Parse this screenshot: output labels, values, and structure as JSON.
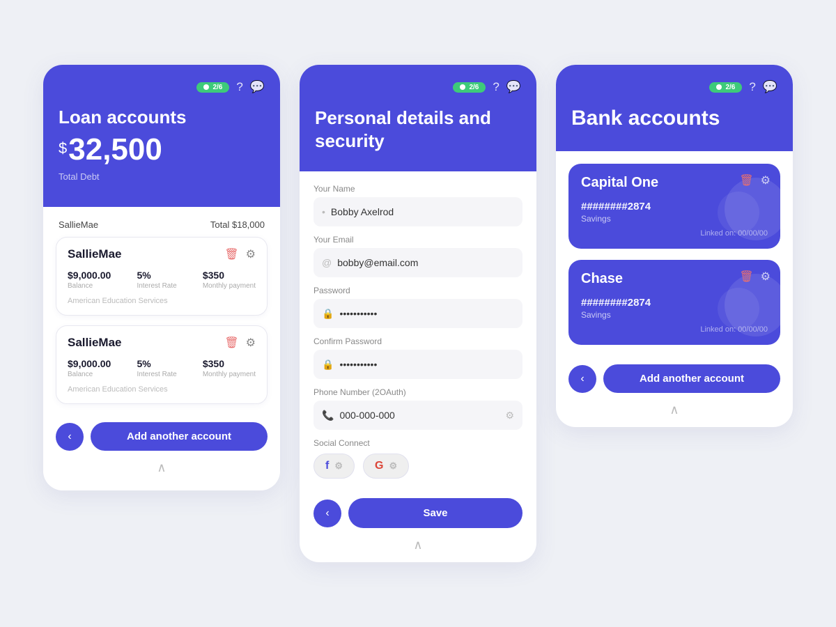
{
  "screen1": {
    "toggle": "2/6",
    "title": "Loan accounts",
    "amount": "32,500",
    "subtitle": "Total Debt",
    "section_name": "SallieMae",
    "section_total": "Total $18,000",
    "accounts": [
      {
        "name": "SallieMae",
        "balance_value": "$9,000.00",
        "balance_label": "Balance",
        "rate_value": "5%",
        "rate_label": "Interest Rate",
        "payment_value": "$350",
        "payment_label": "Monthly payment",
        "provider": "American Education Services"
      },
      {
        "name": "SallieMae",
        "balance_value": "$9,000.00",
        "balance_label": "Balance",
        "rate_value": "5%",
        "rate_label": "Interest Rate",
        "payment_value": "$350",
        "payment_label": "Monthly payment",
        "provider": "American Education Services"
      }
    ],
    "add_btn": "Add another account"
  },
  "screen2": {
    "toggle": "2/6",
    "title": "Personal details and security",
    "fields": {
      "name_label": "Your Name",
      "name_value": "Bobby Axelrod",
      "email_label": "Your Email",
      "email_value": "bobby@email.com",
      "password_label": "Password",
      "password_value": "••••••••••••",
      "confirm_label": "Confirm Password",
      "confirm_value": "••••••••••••",
      "phone_label": "Phone Number (2OAuth)",
      "phone_value": "000-000-000"
    },
    "social_label": "Social Connect",
    "facebook_label": "f",
    "google_label": "G",
    "save_btn": "Save"
  },
  "screen3": {
    "toggle": "2/6",
    "title": "Bank accounts",
    "cards": [
      {
        "name": "Capital One",
        "number": "########2874",
        "type": "Savings",
        "linked": "Linked on: 00/00/00"
      },
      {
        "name": "Chase",
        "number": "########2874",
        "type": "Savings",
        "linked": "Linked on: 00/00/00"
      }
    ],
    "add_btn": "Add another account"
  },
  "icons": {
    "question": "?",
    "chat": "💬",
    "back_chevron": "‹",
    "up_chevron": "∧",
    "delete": "🗑",
    "gear": "⚙",
    "phone_icon": "📞",
    "email_icon": "@",
    "lock_icon": "🔒",
    "user_dot": "•"
  }
}
